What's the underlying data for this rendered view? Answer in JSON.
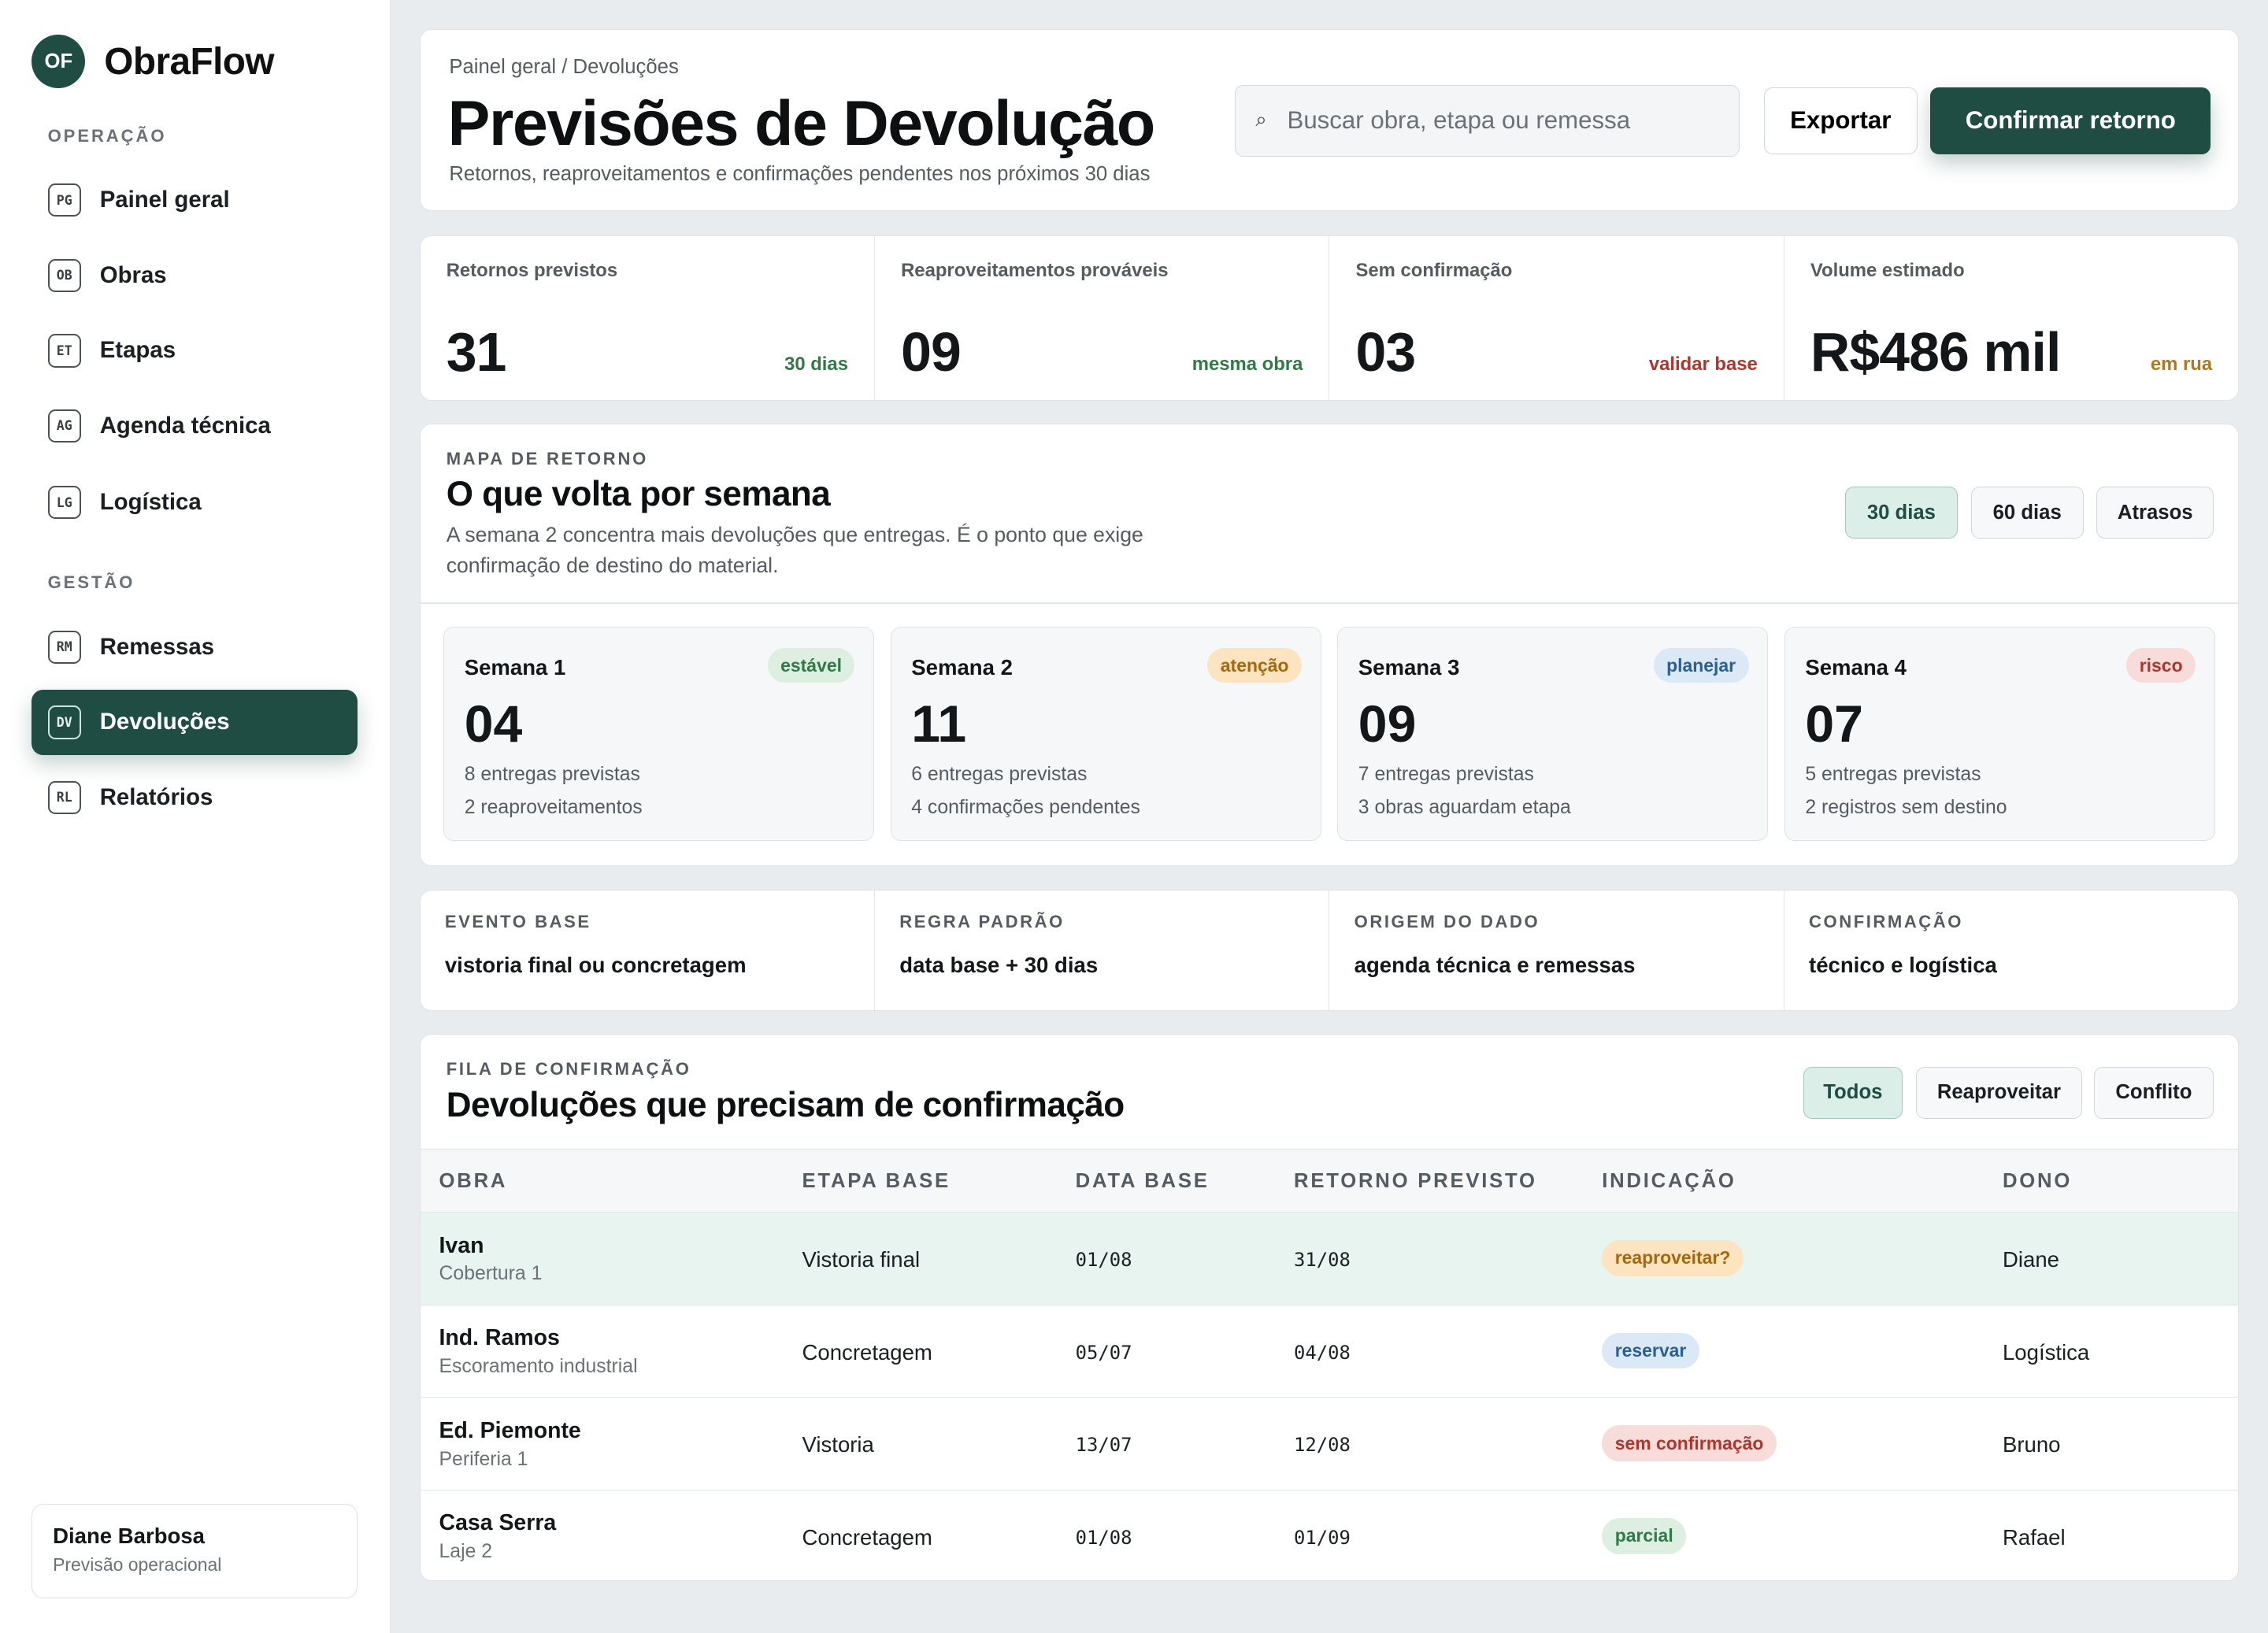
{
  "brand": {
    "logo": "OF",
    "name": "ObraFlow",
    "accent": "#1f4d44"
  },
  "sidebar": {
    "section_operation": "OPERAÇÃO",
    "section_management": "GESTÃO",
    "items": [
      {
        "abbr": "PG",
        "label": "Painel geral"
      },
      {
        "abbr": "OB",
        "label": "Obras"
      },
      {
        "abbr": "ET",
        "label": "Etapas"
      },
      {
        "abbr": "AG",
        "label": "Agenda técnica"
      },
      {
        "abbr": "LG",
        "label": "Logística"
      },
      {
        "abbr": "RM",
        "label": "Remessas"
      },
      {
        "abbr": "DV",
        "label": "Devoluções"
      },
      {
        "abbr": "RL",
        "label": "Relatórios"
      }
    ],
    "user": {
      "name": "Diane Barbosa",
      "role": "Previsão operacional"
    }
  },
  "header": {
    "breadcrumb": "Painel geral / Devoluções",
    "title": "Previsões de Devolução",
    "subtitle": "Retornos, reaproveitamentos e confirmações pendentes nos próximos 30 dias",
    "search_placeholder": "Buscar obra, etapa ou remessa",
    "search_icon": "⌕",
    "export_label": "Exportar",
    "confirm_label": "Confirmar retorno"
  },
  "kpis": [
    {
      "label": "Retornos previstos",
      "value": "31",
      "note": "30 dias"
    },
    {
      "label": "Reaproveitamentos prováveis",
      "value": "09",
      "note": "mesma obra"
    },
    {
      "label": "Sem confirmação",
      "value": "03",
      "note": "validar base"
    },
    {
      "label": "Volume estimado",
      "value": "R$486 mil",
      "note": "em rua"
    }
  ],
  "weeks": {
    "eyebrow": "MAPA DE RETORNO",
    "title": "O que volta por semana",
    "description": "A semana 2 concentra mais devoluções que entregas. É o ponto que exige confirmação de destino do material.",
    "filters": [
      "30 dias",
      "60 dias",
      "Atrasos"
    ],
    "cards": [
      {
        "name": "Semana 1",
        "badge": "estável",
        "value": "04",
        "line1": "8 entregas previstas",
        "line2": "2 reaproveitamentos"
      },
      {
        "name": "Semana 2",
        "badge": "atenção",
        "value": "11",
        "line1": "6 entregas previstas",
        "line2": "4 confirmações pendentes"
      },
      {
        "name": "Semana 3",
        "badge": "planejar",
        "value": "09",
        "line1": "7 entregas previstas",
        "line2": "3 obras aguardam etapa"
      },
      {
        "name": "Semana 4",
        "badge": "risco",
        "value": "07",
        "line1": "5 entregas previstas",
        "line2": "2 registros sem destino"
      }
    ]
  },
  "rules": [
    {
      "label": "EVENTO BASE",
      "value": "vistoria final ou concretagem"
    },
    {
      "label": "REGRA PADRÃO",
      "value": "data base + 30 dias"
    },
    {
      "label": "ORIGEM DO DADO",
      "value": "agenda técnica e remessas"
    },
    {
      "label": "CONFIRMAÇÃO",
      "value": "técnico e logística"
    }
  ],
  "queue": {
    "eyebrow": "FILA DE CONFIRMAÇÃO",
    "title": "Devoluções que precisam de confirmação",
    "filters": [
      "Todos",
      "Reaproveitar",
      "Conflito"
    ],
    "columns": [
      "OBRA",
      "ETAPA BASE",
      "DATA BASE",
      "RETORNO PREVISTO",
      "INDICAÇÃO",
      "DONO"
    ],
    "rows": [
      {
        "obra": "Ivan",
        "sub": "Cobertura 1",
        "etapa": "Vistoria final",
        "data": "01/08",
        "retorno": "31/08",
        "indicacao": "reaproveitar?",
        "dono": "Diane"
      },
      {
        "obra": "Ind. Ramos",
        "sub": "Escoramento industrial",
        "etapa": "Concretagem",
        "data": "05/07",
        "retorno": "04/08",
        "indicacao": "reservar",
        "dono": "Logística"
      },
      {
        "obra": "Ed. Piemonte",
        "sub": "Periferia 1",
        "etapa": "Vistoria",
        "data": "13/07",
        "retorno": "12/08",
        "indicacao": "sem confirmação",
        "dono": "Bruno"
      },
      {
        "obra": "Casa Serra",
        "sub": "Laje 2",
        "etapa": "Concretagem",
        "data": "01/08",
        "retorno": "01/09",
        "indicacao": "parcial",
        "dono": "Rafael"
      }
    ]
  }
}
